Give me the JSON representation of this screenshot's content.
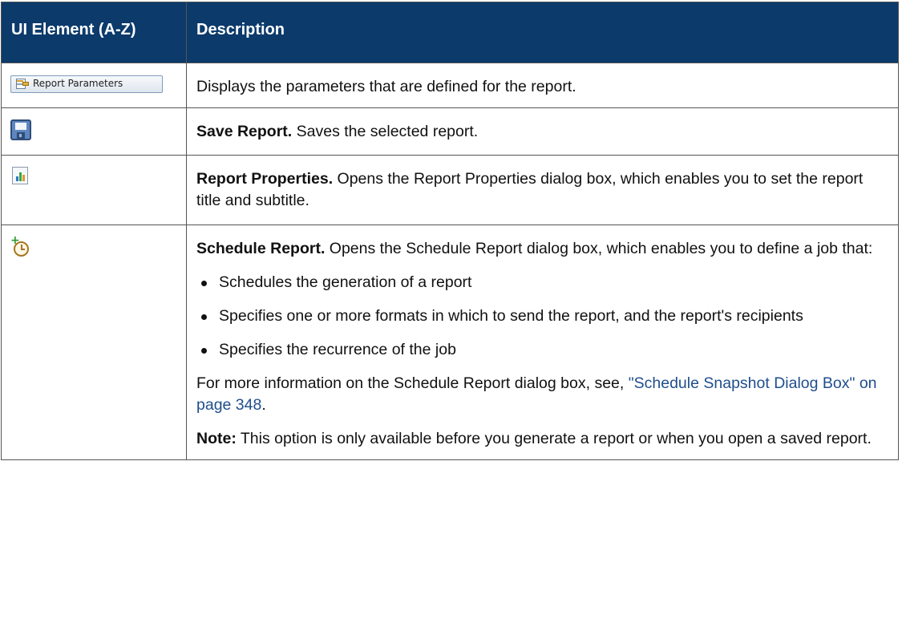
{
  "header": {
    "col_element": "UI Element (A-Z)",
    "col_description": "Description"
  },
  "rows": [
    {
      "icon": "report-parameters-button",
      "button_label": "Report Parameters",
      "description": "Displays the parameters that are defined for the report."
    },
    {
      "icon": "save-icon",
      "title": "Save Report.",
      "description": " Saves the selected report."
    },
    {
      "icon": "report-properties-icon",
      "title": "Report Properties.",
      "description": " Opens the Report Properties dialog box, which enables you to set the report title and subtitle."
    },
    {
      "icon": "schedule-report-icon",
      "title": "Schedule Report.",
      "description": " Opens the Schedule Report dialog box, which enables you to define a job that:",
      "bullets": [
        "Schedules the generation of a report",
        "Specifies one or more formats in which to send the report, and the report's recipients",
        "Specifies the recurrence of the job"
      ],
      "more_info_prefix": "For more information on the Schedule Report dialog box, see, ",
      "more_info_link": "\"Schedule Snapshot Dialog Box\" on page 348",
      "more_info_suffix": ".",
      "note_label": "Note:",
      "note_text": " This option is only available before you generate a report or when you open a saved report."
    }
  ]
}
